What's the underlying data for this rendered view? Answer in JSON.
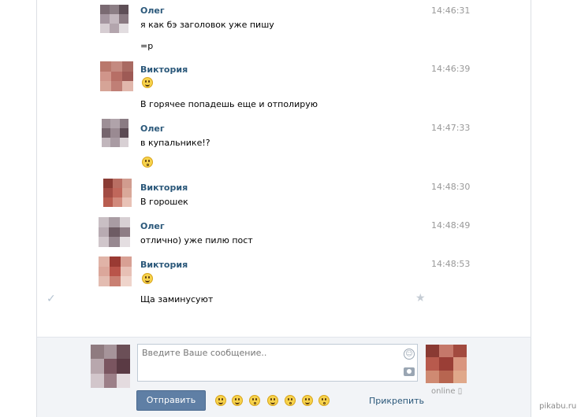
{
  "messages": [
    {
      "author": "Олег",
      "time": "14:46:31",
      "lines": [
        "я как бэ заголовок уже пишу",
        "=р"
      ]
    },
    {
      "author": "Виктория",
      "time": "14:46:39",
      "lines": [
        "В горячее попадешь еще и отполирую"
      ]
    },
    {
      "author": "Олег",
      "time": "14:47:33",
      "lines": [
        "в купальнике!?"
      ]
    },
    {
      "author": "Виктория",
      "time": "14:48:30",
      "lines": [
        "В горошек"
      ]
    },
    {
      "author": "Олег",
      "time": "14:48:49",
      "lines": [
        "отлично) уже пилю пост"
      ]
    },
    {
      "author": "Виктория",
      "time": "14:48:53",
      "lines": [
        "Ща заминусуют"
      ]
    }
  ],
  "composer": {
    "placeholder": "Введите Ваше сообщение..",
    "send_label": "Отправить",
    "attach_label": "Прикрепить",
    "status": "online"
  },
  "icons": {
    "read_check": "check-icon",
    "favorite": "star-icon",
    "emoji_button": "smile-icon",
    "photo": "camera-icon",
    "mobile": "phone-icon"
  },
  "colors": {
    "author": "#2b587a",
    "send_button": "#5f7fa5",
    "time": "#999999"
  },
  "watermark": "pikabu.ru"
}
